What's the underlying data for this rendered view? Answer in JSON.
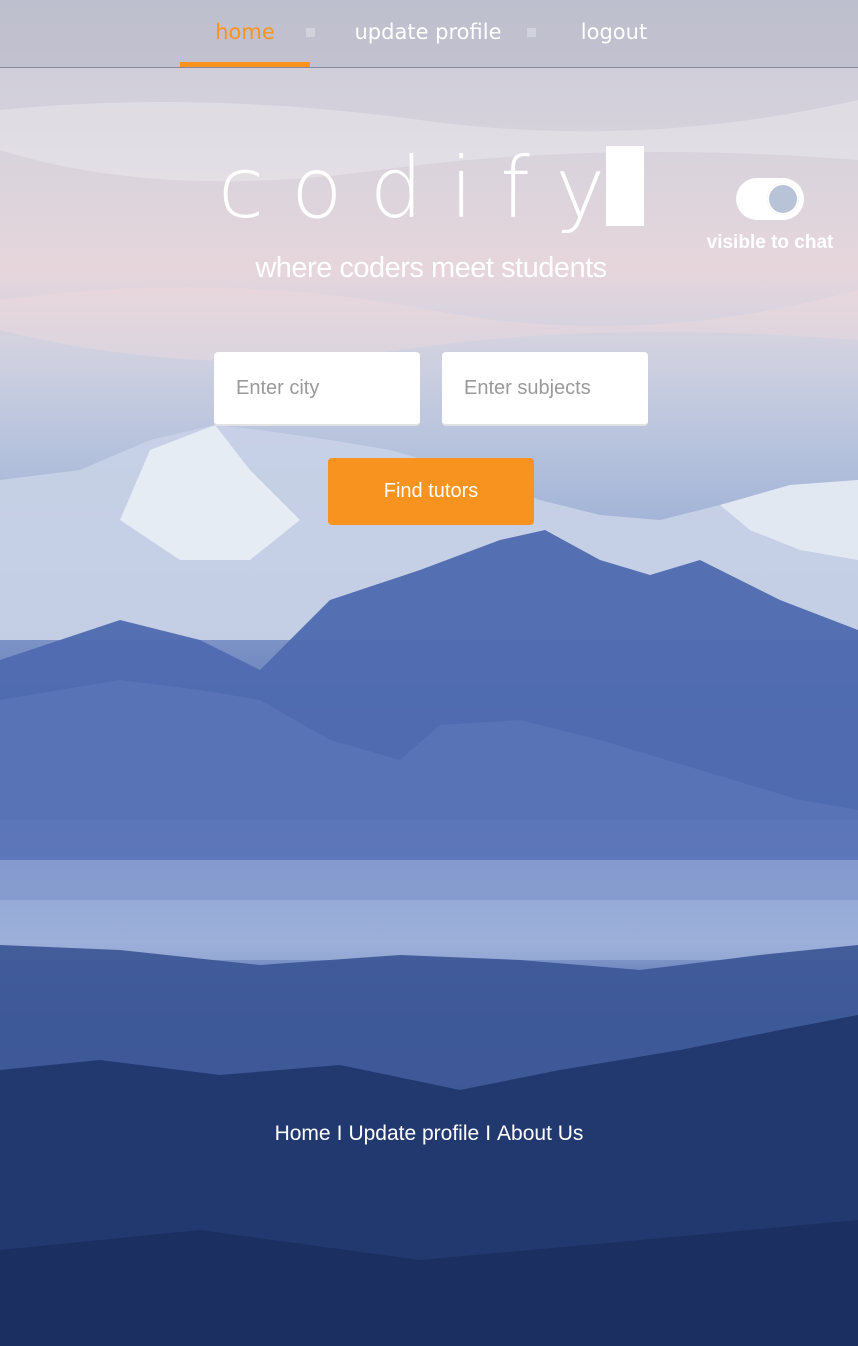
{
  "nav": {
    "items": [
      {
        "label": "home",
        "active": true
      },
      {
        "label": "update profile",
        "active": false
      },
      {
        "label": "logout",
        "active": false
      }
    ]
  },
  "brand": {
    "logo_text": "codify",
    "tagline": "where coders meet students"
  },
  "chat_toggle": {
    "label": "visible to chat",
    "on": true
  },
  "search": {
    "city_placeholder": "Enter city",
    "city_value": "",
    "subjects_placeholder": "Enter subjects",
    "subjects_value": "",
    "button_label": "Find tutors"
  },
  "footer": {
    "links": [
      "Home",
      "Update profile",
      "About Us"
    ],
    "separator": "I"
  },
  "colors": {
    "accent": "#f7931e",
    "text": "#ffffff"
  }
}
